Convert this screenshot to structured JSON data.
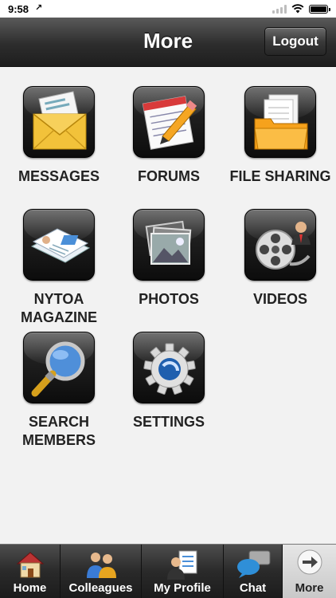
{
  "status_bar": {
    "time": "9:58",
    "location_glyph": "↗"
  },
  "header": {
    "title": "More",
    "logout_label": "Logout"
  },
  "tiles": [
    {
      "label": "MESSAGES",
      "icon": "envelope-icon"
    },
    {
      "label": "FORUMS",
      "icon": "pencil-notepad-icon"
    },
    {
      "label": "FILE SHARING",
      "icon": "folder-icon"
    },
    {
      "label": "NYTOA\nMAGAZINE",
      "icon": "magazine-icon"
    },
    {
      "label": "PHOTOS",
      "icon": "photos-icon"
    },
    {
      "label": "VIDEOS",
      "icon": "film-reel-icon"
    },
    {
      "label": "SEARCH\nMEMBERS",
      "icon": "magnifier-icon"
    },
    {
      "label": "SETTINGS",
      "icon": "gear-icon"
    }
  ],
  "tabbar": {
    "items": [
      {
        "label": "Home",
        "icon": "house-icon"
      },
      {
        "label": "Colleagues",
        "icon": "people-icon"
      },
      {
        "label": "My Profile",
        "icon": "profile-icon"
      },
      {
        "label": "Chat",
        "icon": "chat-bubbles-icon"
      },
      {
        "label": "More",
        "icon": "arrow-right-icon"
      }
    ],
    "active": "More"
  },
  "colors": {
    "header_dark": "#2d2d2d",
    "label_text": "#222222",
    "background": "#f2f2f2"
  }
}
